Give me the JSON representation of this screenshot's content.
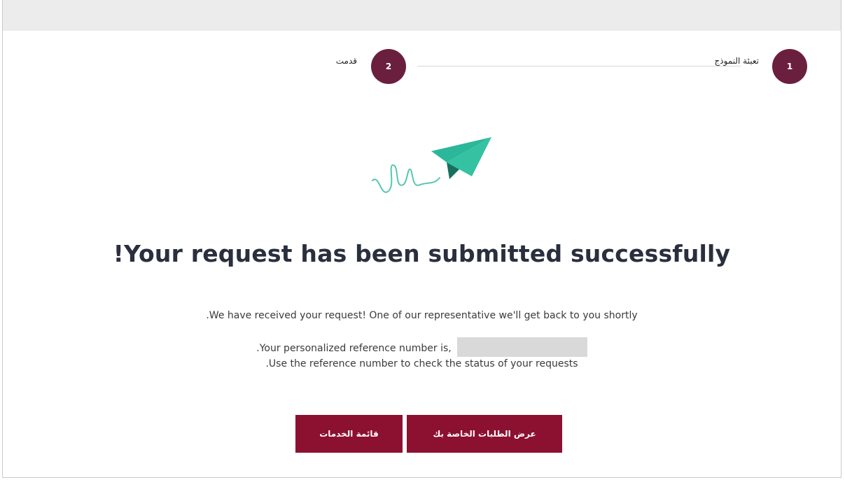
{
  "stepper": {
    "steps": [
      {
        "number": "1",
        "label": "تعبئة النموذج"
      },
      {
        "number": "2",
        "label": "قدمت"
      }
    ],
    "accent_color": "#6b1f3e"
  },
  "illustration": {
    "icon": "paper-plane-icon",
    "colors": [
      "#2bb79a",
      "#1a8a73",
      "#56c8b0"
    ]
  },
  "content": {
    "headline": "!Your request has been submitted successfully",
    "received_message": ".We have received your request! One of our representative we'll get back to you shortly",
    "reference_message": ".Your personalized reference number is,",
    "reference_number": "",
    "usage_message": ".Use the reference number to check the status of your requests"
  },
  "actions": {
    "services_list_label": "قائمة الخدمات",
    "view_requests_label": "عرض الطلبات الخاصة بك",
    "button_color": "#8c1030"
  }
}
